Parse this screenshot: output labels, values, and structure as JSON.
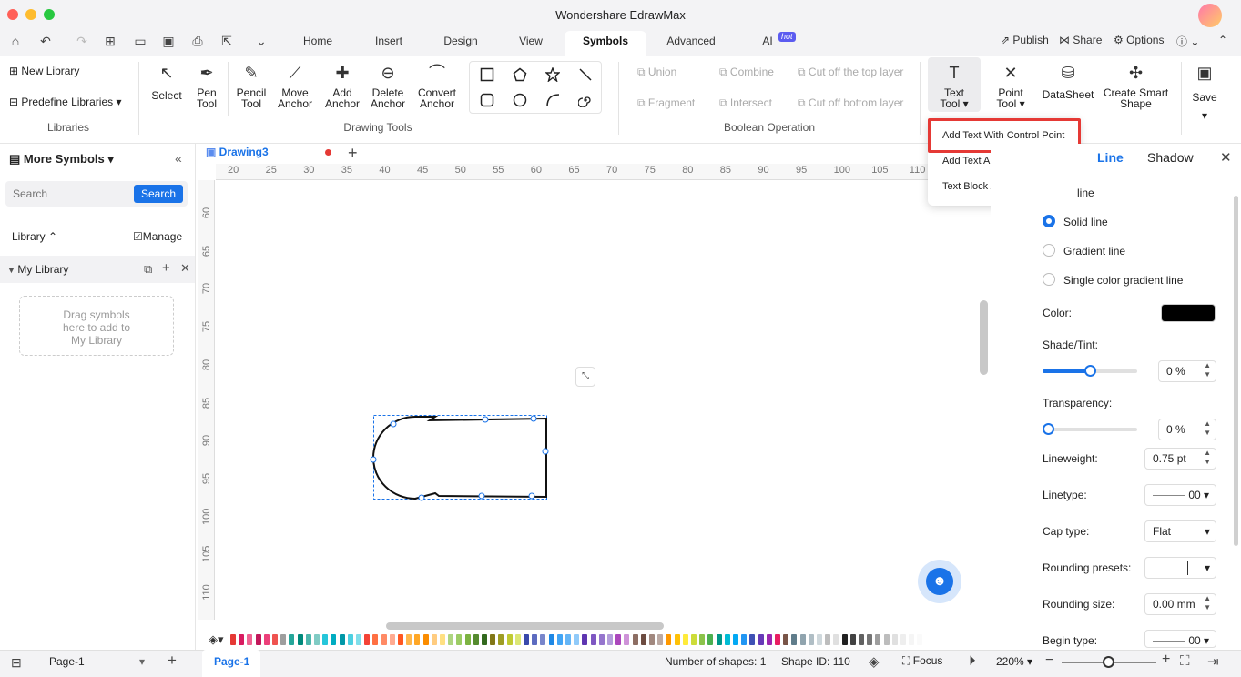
{
  "app_title": "Wondershare EdrawMax",
  "menu_tabs": [
    "Home",
    "Insert",
    "Design",
    "View",
    "Symbols",
    "Advanced",
    "AI"
  ],
  "active_tab": "Symbols",
  "ai_badge": "hot",
  "top_right": {
    "publish": "Publish",
    "share": "Share",
    "options": "Options"
  },
  "ribbon": {
    "libraries": {
      "new_library": "New Library",
      "predefine": "Predefine Libraries",
      "group": "Libraries"
    },
    "drawing": {
      "select": "Select",
      "pen": [
        "Pen",
        "Tool"
      ],
      "pencil": [
        "Pencil",
        "Tool"
      ],
      "move": [
        "Move",
        "Anchor"
      ],
      "add": [
        "Add",
        "Anchor"
      ],
      "delete": [
        "Delete",
        "Anchor"
      ],
      "convert": [
        "Convert",
        "Anchor"
      ],
      "group": "Drawing Tools"
    },
    "boolean": {
      "union": "Union",
      "combine": "Combine",
      "cut_top": "Cut off the top layer",
      "fragment": "Fragment",
      "intersect": "Intersect",
      "cut_bottom": "Cut off bottom layer",
      "group": "Boolean Operation"
    },
    "text_tool": [
      "Text",
      "Tool"
    ],
    "point_tool": [
      "Point",
      "Tool"
    ],
    "datasheet": "DataSheet",
    "smart_shape": [
      "Create Smart",
      "Shape"
    ],
    "save": "Save"
  },
  "dropdown": {
    "items": [
      "Add Text With Control Point",
      "Add Text Above The Shape",
      "Text Block Adjust Tool"
    ]
  },
  "left_panel": {
    "title": "More Symbols",
    "search_placeholder": "Search",
    "search_button": "Search",
    "library_label": "Library",
    "manage": "Manage",
    "my_library": "My Library",
    "drop_hint": [
      "Drag symbols",
      "here to add to",
      "My Library"
    ]
  },
  "doc_tab": "Drawing3",
  "ruler_h": [
    "20",
    "25",
    "30",
    "35",
    "40",
    "45",
    "50",
    "55",
    "60",
    "65",
    "70",
    "75",
    "80",
    "85",
    "90",
    "95",
    "100",
    "105",
    "110"
  ],
  "ruler_v": [
    "60",
    "65",
    "70",
    "75",
    "80",
    "85",
    "90",
    "95",
    "100",
    "105",
    "110"
  ],
  "right_panel": {
    "tabs": [
      "Line",
      "Shadow"
    ],
    "line_partial": "line",
    "solid": "Solid line",
    "gradient": "Gradient line",
    "single": "Single color gradient line",
    "color": "Color:",
    "color_value": "#000000",
    "shade": "Shade/Tint:",
    "shade_value": "0 %",
    "shade_level": 0.5,
    "transparency": "Transparency:",
    "transparency_value": "0 %",
    "lineweight": "Lineweight:",
    "lineweight_value": "0.75 pt",
    "linetype": "Linetype:",
    "linetype_value": "00",
    "cap": "Cap type:",
    "cap_value": "Flat",
    "rounding_presets": "Rounding presets:",
    "rounding_size": "Rounding size:",
    "rounding_size_value": "0.00 mm",
    "begin": "Begin type:",
    "begin_value": "00"
  },
  "status": {
    "page_select": "Page-1",
    "page_tab": "Page-1",
    "shapes": "Number of shapes: 1",
    "shape_id": "Shape ID: 110",
    "focus": "Focus",
    "zoom": "220%"
  },
  "palette": [
    "#e53935",
    "#d81b60",
    "#f06292",
    "#c2185b",
    "#ec407a",
    "#ef5350",
    "#9e9e9e",
    "#26a69a",
    "#00897b",
    "#4db6ac",
    "#80cbc4",
    "#26c6da",
    "#00acc1",
    "#0097a7",
    "#4dd0e1",
    "#80deea",
    "#f44336",
    "#ff7043",
    "#ff8a65",
    "#ffab91",
    "#ff5722",
    "#ffb74d",
    "#ffa726",
    "#fb8c00",
    "#ffcc80",
    "#ffe082",
    "#aed581",
    "#9ccc65",
    "#7cb342",
    "#558b2f",
    "#33691e",
    "#827717",
    "#9e9d24",
    "#c0ca33",
    "#dce775",
    "#3949ab",
    "#5c6bc0",
    "#7986cb",
    "#1e88e5",
    "#42a5f5",
    "#64b5f6",
    "#90caf9",
    "#5e35b1",
    "#7e57c2",
    "#9575cd",
    "#b39ddb",
    "#ab47bc",
    "#ce93d8",
    "#8d6e63",
    "#6d4c41",
    "#a1887f",
    "#bcaaa4",
    "#ff9800",
    "#ffc107",
    "#ffeb3b",
    "#cddc39",
    "#8bc34a",
    "#4caf50",
    "#009688",
    "#00bcd4",
    "#03a9f4",
    "#2196f3",
    "#3f51b5",
    "#673ab7",
    "#9c27b0",
    "#e91e63",
    "#795548",
    "#607d8b",
    "#90a4ae",
    "#b0bec5",
    "#cfd8dc",
    "#bdbdbd",
    "#e0e0e0",
    "#212121",
    "#424242",
    "#616161",
    "#757575",
    "#9e9e9e",
    "#bdbdbd",
    "#e0e0e0",
    "#eeeeee",
    "#f5f5f5",
    "#fafafa"
  ]
}
